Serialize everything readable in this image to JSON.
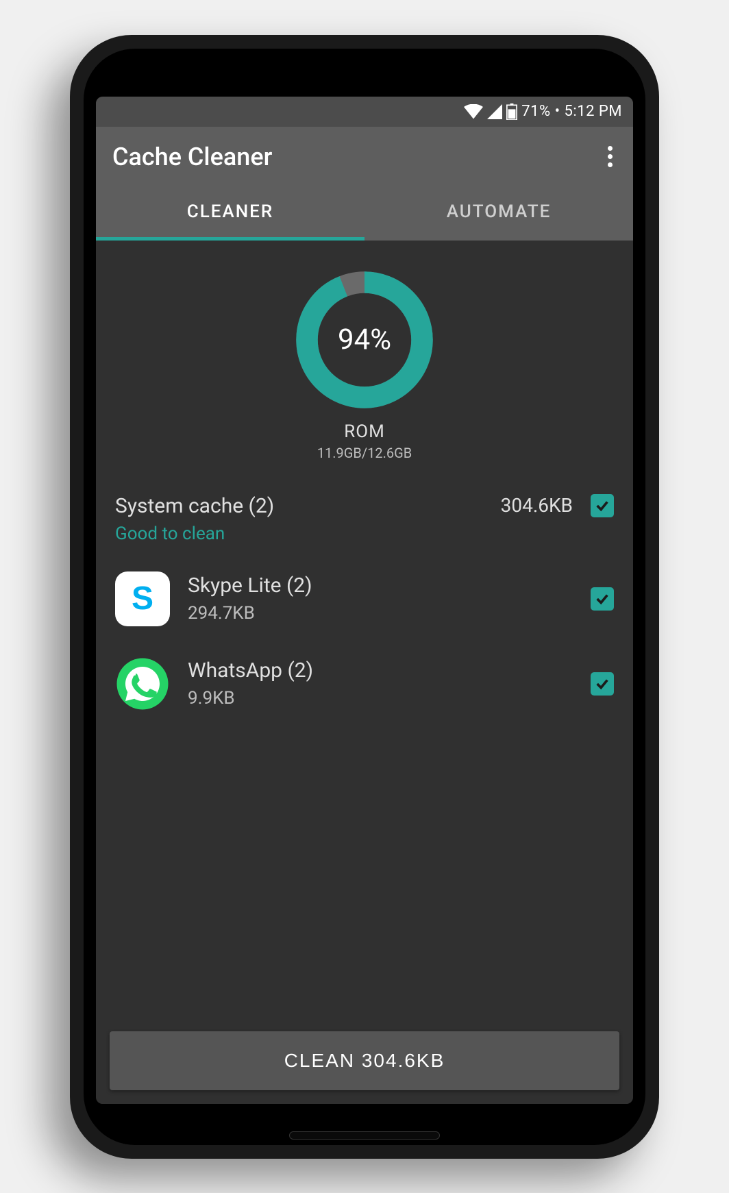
{
  "status_bar": {
    "battery": "71%",
    "time": "5:12 PM"
  },
  "app": {
    "title": "Cache Cleaner"
  },
  "tabs": {
    "cleaner": "CLEANER",
    "automate": "AUTOMATE"
  },
  "ring": {
    "percent_value": 94,
    "percent_label": "94%",
    "label": "ROM",
    "sub": "11.9GB/12.6GB"
  },
  "section": {
    "title": "System cache (2)",
    "hint": "Good to clean",
    "size": "304.6KB"
  },
  "apps": [
    {
      "name": "Skype Lite (2)",
      "size": "294.7KB",
      "icon": "skype"
    },
    {
      "name": "WhatsApp (2)",
      "size": "9.9KB",
      "icon": "whatsapp"
    }
  ],
  "clean_button": "CLEAN 304.6KB",
  "colors": {
    "accent": "#26a69a"
  }
}
